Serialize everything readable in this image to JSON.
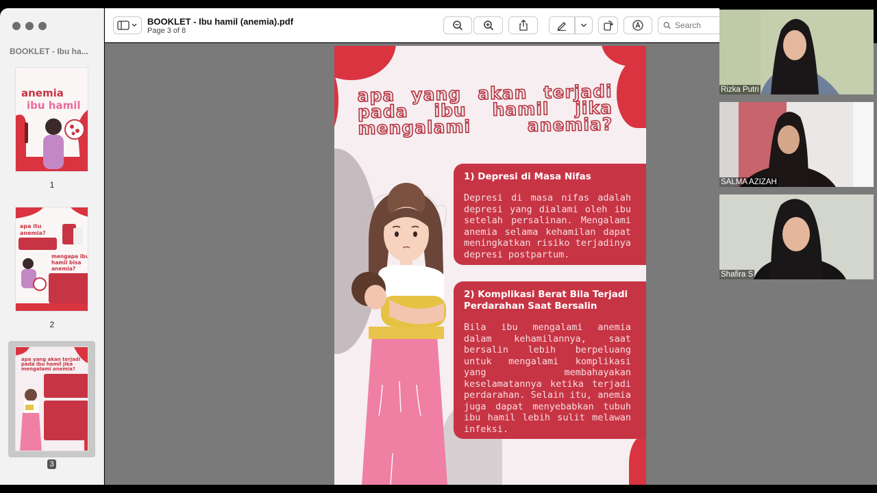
{
  "window": {
    "document_title": "BOOKLET - Ibu hamil (anemia).pdf",
    "page_indicator": "Page 3 of 8"
  },
  "sidebar": {
    "title": "BOOKLET - Ibu ha...",
    "thumbnails": [
      {
        "number": "1",
        "selected": false
      },
      {
        "number": "2",
        "selected": false
      },
      {
        "number": "3",
        "selected": true
      }
    ]
  },
  "toolbar": {
    "search_placeholder": "Search",
    "icons": [
      "sidebar-toggle-icon",
      "zoom-out-icon",
      "zoom-in-icon",
      "share-icon",
      "markup-pen-icon",
      "chevron-down-icon",
      "rotate-icon",
      "annotate-icon",
      "search-icon"
    ]
  },
  "page": {
    "heading": "apa yang akan terjadi pada ibu hamil jika mengalami anemia?",
    "cards": [
      {
        "title": "1) Depresi di Masa Nifas",
        "body": "Depresi di masa nifas adalah depresi yang dialami oleh ibu setelah persalinan. Mengalami anemia selama kehamilan dapat meningkatkan risiko terjadinya depresi postpartum."
      },
      {
        "title": "2) Komplikasi Berat Bila Terjadi Perdarahan Saat Bersalin",
        "body": "Bila ibu mengalami anemia dalam kehamilannya, saat bersalin lebih berpeluang untuk mengalami komplikasi yang membahayakan keselamatannya ketika terjadi perdarahan. Selain itu, anemia juga dapat menyebabkan tubuh ibu hamil lebih sulit melawan infeksi."
      }
    ],
    "colors": {
      "accent": "#c73444",
      "blob": "#d93440",
      "background": "#f6eef0"
    }
  },
  "participants": [
    {
      "name": "Rizka Putri"
    },
    {
      "name": "SALMA AZIZAH"
    },
    {
      "name": "Shafira S"
    }
  ]
}
